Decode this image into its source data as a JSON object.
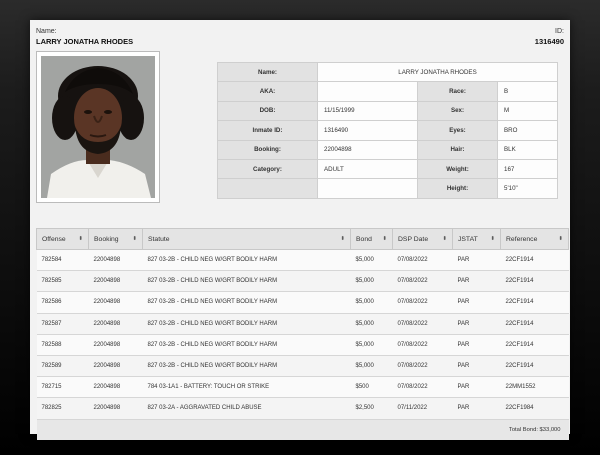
{
  "header": {
    "name_label": "Name:",
    "name": "LARRY JONATHA RHODES",
    "id_label": "ID:",
    "id": "1316490"
  },
  "info": {
    "name_label": "Name:",
    "name": "LARRY JONATHA RHODES",
    "aka_label": "AKA:",
    "aka": "",
    "race_label": "Race:",
    "race": "B",
    "dob_label": "DOB:",
    "dob": "11/15/1999",
    "sex_label": "Sex:",
    "sex": "M",
    "inmate_id_label": "Inmate ID:",
    "inmate_id": "1316490",
    "eyes_label": "Eyes:",
    "eyes": "BRO",
    "booking_label": "Booking:",
    "booking": "22004898",
    "hair_label": "Hair:",
    "hair": "BLK",
    "category_label": "Category:",
    "category": "ADULT",
    "weight_label": "Weight:",
    "weight": "167",
    "height_label": "Height:",
    "height": "5'10\""
  },
  "offenses": {
    "headers": [
      "Offense",
      "Booking",
      "Statute",
      "Bond",
      "DSP Date",
      "JSTAT",
      "Reference"
    ],
    "sort_icon": "⬍",
    "rows": [
      {
        "offense": "782584",
        "booking": "22004898",
        "statute": "827 03-2B - CHILD NEG W/GRT BODILY HARM",
        "bond": "$5,000",
        "dsp_date": "07/08/2022",
        "jstat": "PAR",
        "reference": "22CF1914"
      },
      {
        "offense": "782585",
        "booking": "22004898",
        "statute": "827 03-2B - CHILD NEG W/GRT BODILY HARM",
        "bond": "$5,000",
        "dsp_date": "07/08/2022",
        "jstat": "PAR",
        "reference": "22CF1914"
      },
      {
        "offense": "782586",
        "booking": "22004898",
        "statute": "827 03-2B - CHILD NEG W/GRT BODILY HARM",
        "bond": "$5,000",
        "dsp_date": "07/08/2022",
        "jstat": "PAR",
        "reference": "22CF1914"
      },
      {
        "offense": "782587",
        "booking": "22004898",
        "statute": "827 03-2B - CHILD NEG W/GRT BODILY HARM",
        "bond": "$5,000",
        "dsp_date": "07/08/2022",
        "jstat": "PAR",
        "reference": "22CF1914"
      },
      {
        "offense": "782588",
        "booking": "22004898",
        "statute": "827 03-2B - CHILD NEG W/GRT BODILY HARM",
        "bond": "$5,000",
        "dsp_date": "07/08/2022",
        "jstat": "PAR",
        "reference": "22CF1914"
      },
      {
        "offense": "782589",
        "booking": "22004898",
        "statute": "827 03-2B - CHILD NEG W/GRT BODILY HARM",
        "bond": "$5,000",
        "dsp_date": "07/08/2022",
        "jstat": "PAR",
        "reference": "22CF1914"
      },
      {
        "offense": "782715",
        "booking": "22004898",
        "statute": "784 03-1A1 - BATTERY: TOUCH OR STRIKE",
        "bond": "$500",
        "dsp_date": "07/08/2022",
        "jstat": "PAR",
        "reference": "22MM1552"
      },
      {
        "offense": "782825",
        "booking": "22004898",
        "statute": "827 03-2A - AGGRAVATED CHILD ABUSE",
        "bond": "$2,500",
        "dsp_date": "07/11/2022",
        "jstat": "PAR",
        "reference": "22CF1984"
      }
    ],
    "total_bond": "Total Bond: $33,000"
  },
  "colors": {
    "card": "#f2f2f2",
    "label_cell": "#e2e2e2",
    "table_header": "#e4e4e4",
    "photo_background": "#9b9d9b"
  },
  "icons": {
    "sort": "sort-icon"
  }
}
